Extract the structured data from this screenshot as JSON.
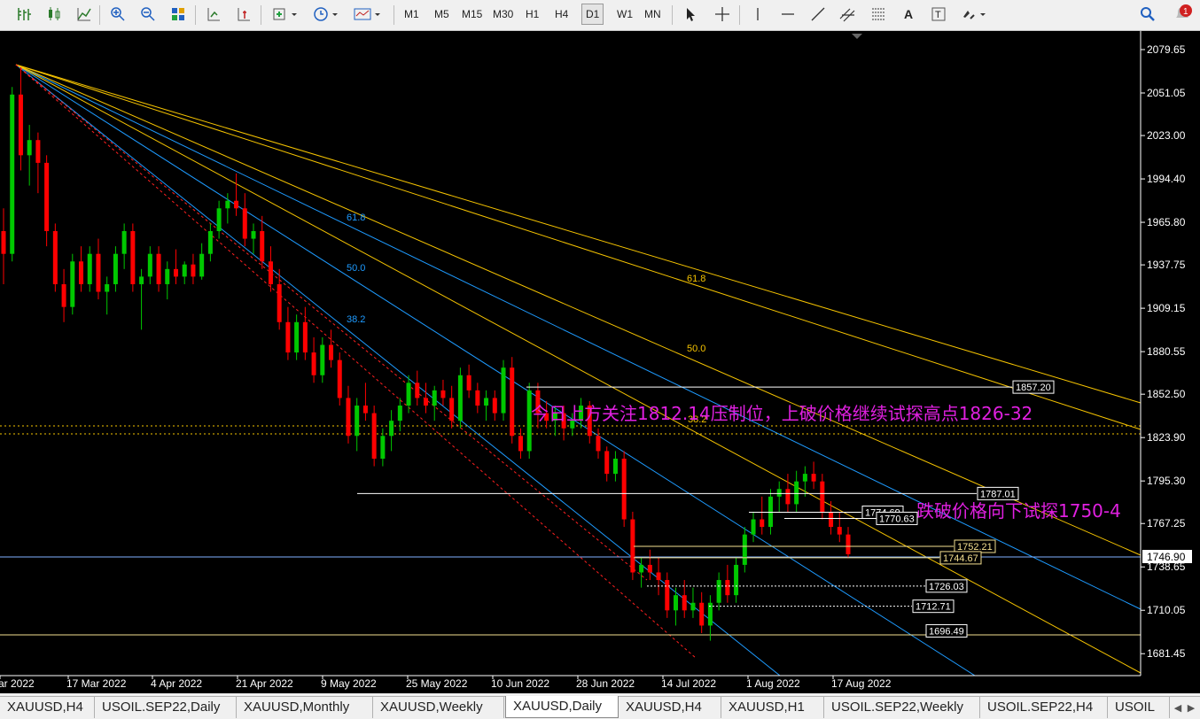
{
  "toolbar": {
    "timeframes": [
      "M1",
      "M5",
      "M15",
      "M30",
      "H1",
      "H4",
      "D1",
      "W1",
      "MN"
    ],
    "active_timeframe": "D1",
    "notification_count": "1"
  },
  "price_axis": {
    "ticks": [
      "2079.65",
      "2051.05",
      "2023.00",
      "1994.40",
      "1965.80",
      "1937.75",
      "1909.15",
      "1880.55",
      "1852.50",
      "1823.90",
      "1795.30",
      "1767.25",
      "1738.65",
      "1710.05",
      "1681.45"
    ],
    "current_price": "1746.90"
  },
  "time_axis": {
    "ticks": [
      "ar 2022",
      "17 Mar 2022",
      "4 Apr 2022",
      "21 Apr 2022",
      "9 May 2022",
      "25 May 2022",
      "10 Jun 2022",
      "28 Jun 2022",
      "14 Jul 2022",
      "1 Aug 2022",
      "17 Aug 2022"
    ]
  },
  "fib_labels": {
    "blue": [
      "61.8",
      "50.0",
      "38.2"
    ],
    "yellow": [
      "61.8",
      "50.0",
      "38.2"
    ]
  },
  "levels": [
    "1857.20",
    "1787.01",
    "1774.69",
    "1770.63",
    "1752.21",
    "1744.67",
    "1726.03",
    "1712.71",
    "1696.49"
  ],
  "annotations": {
    "upper": "今日上方关注1812.14压制位，上破价格继续试探高点1826-32",
    "lower": "跌破价格向下试探1750-4"
  },
  "tabs": [
    "XAUUSD,H4",
    "USOIL.SEP22,Daily",
    "XAUUSD,Monthly",
    "XAUUSD,Weekly",
    "XAUUSD,Daily",
    "XAUUSD,H4",
    "XAUUSD,H1",
    "USOIL.SEP22,Weekly",
    "USOIL.SEP22,H4",
    "USOIL"
  ],
  "active_tab": "XAUUSD,Daily",
  "colors": {
    "bull": "#00c800",
    "bear": "#ff0000",
    "blue_fan": "#1e9bff",
    "yellow_fan": "#f5c300",
    "annotation": "#e020e0",
    "channel": "#ff2020"
  },
  "chart_data": {
    "type": "candlestick",
    "symbol": "XAUUSD",
    "timeframe": "Daily",
    "y_range": [
      1672,
      2092
    ],
    "current_price": 1746.9,
    "horizontal_levels": [
      1857.2,
      1787.01,
      1774.69,
      1770.63,
      1752.21,
      1744.67,
      1726.03,
      1712.71,
      1696.49
    ],
    "candles": [
      [
        1960,
        1975,
        1925,
        1945
      ],
      [
        1945,
        2055,
        1940,
        2050
      ],
      [
        2050,
        2068,
        2000,
        2010
      ],
      [
        2010,
        2030,
        1990,
        2020
      ],
      [
        2020,
        2025,
        1985,
        2005
      ],
      [
        2005,
        2010,
        1950,
        1960
      ],
      [
        1960,
        1965,
        1920,
        1925
      ],
      [
        1925,
        1935,
        1900,
        1910
      ],
      [
        1910,
        1945,
        1905,
        1940
      ],
      [
        1940,
        1950,
        1920,
        1925
      ],
      [
        1925,
        1950,
        1920,
        1945
      ],
      [
        1945,
        1955,
        1915,
        1920
      ],
      [
        1920,
        1930,
        1905,
        1925
      ],
      [
        1925,
        1950,
        1920,
        1945
      ],
      [
        1945,
        1965,
        1935,
        1960
      ],
      [
        1960,
        1965,
        1920,
        1925
      ],
      [
        1925,
        1935,
        1895,
        1930
      ],
      [
        1930,
        1950,
        1925,
        1945
      ],
      [
        1945,
        1950,
        1920,
        1925
      ],
      [
        1925,
        1940,
        1915,
        1935
      ],
      [
        1935,
        1948,
        1925,
        1930
      ],
      [
        1930,
        1940,
        1925,
        1938
      ],
      [
        1938,
        1945,
        1925,
        1930
      ],
      [
        1930,
        1952,
        1928,
        1945
      ],
      [
        1945,
        1965,
        1940,
        1960
      ],
      [
        1960,
        1980,
        1955,
        1975
      ],
      [
        1975,
        1985,
        1965,
        1980
      ],
      [
        1980,
        1998,
        1970,
        1975
      ],
      [
        1975,
        1985,
        1950,
        1955
      ],
      [
        1955,
        1965,
        1945,
        1960
      ],
      [
        1960,
        1970,
        1935,
        1940
      ],
      [
        1940,
        1950,
        1920,
        1925
      ],
      [
        1925,
        1935,
        1895,
        1900
      ],
      [
        1900,
        1910,
        1875,
        1880
      ],
      [
        1880,
        1905,
        1875,
        1900
      ],
      [
        1900,
        1910,
        1875,
        1880
      ],
      [
        1880,
        1890,
        1860,
        1865
      ],
      [
        1865,
        1890,
        1860,
        1885
      ],
      [
        1885,
        1895,
        1870,
        1875
      ],
      [
        1875,
        1880,
        1845,
        1850
      ],
      [
        1850,
        1858,
        1820,
        1825
      ],
      [
        1825,
        1850,
        1815,
        1845
      ],
      [
        1845,
        1860,
        1835,
        1840
      ],
      [
        1840,
        1845,
        1805,
        1810
      ],
      [
        1810,
        1830,
        1805,
        1825
      ],
      [
        1825,
        1842,
        1815,
        1835
      ],
      [
        1835,
        1850,
        1828,
        1845
      ],
      [
        1845,
        1865,
        1840,
        1860
      ],
      [
        1860,
        1868,
        1845,
        1850
      ],
      [
        1850,
        1860,
        1840,
        1845
      ],
      [
        1845,
        1858,
        1835,
        1855
      ],
      [
        1855,
        1862,
        1845,
        1850
      ],
      [
        1850,
        1858,
        1830,
        1835
      ],
      [
        1835,
        1870,
        1830,
        1865
      ],
      [
        1865,
        1872,
        1850,
        1855
      ],
      [
        1855,
        1860,
        1840,
        1845
      ],
      [
        1845,
        1855,
        1835,
        1850
      ],
      [
        1850,
        1855,
        1835,
        1840
      ],
      [
        1840,
        1875,
        1835,
        1870
      ],
      [
        1870,
        1877,
        1820,
        1825
      ],
      [
        1825,
        1830,
        1810,
        1815
      ],
      [
        1815,
        1860,
        1810,
        1855
      ],
      [
        1855,
        1860,
        1830,
        1840
      ],
      [
        1840,
        1848,
        1830,
        1835
      ],
      [
        1835,
        1845,
        1825,
        1840
      ],
      [
        1840,
        1845,
        1822,
        1830
      ],
      [
        1830,
        1840,
        1825,
        1835
      ],
      [
        1835,
        1850,
        1830,
        1845
      ],
      [
        1845,
        1848,
        1820,
        1825
      ],
      [
        1825,
        1830,
        1810,
        1815
      ],
      [
        1815,
        1818,
        1795,
        1800
      ],
      [
        1800,
        1815,
        1795,
        1810
      ],
      [
        1810,
        1815,
        1765,
        1770
      ],
      [
        1770,
        1775,
        1730,
        1735
      ],
      [
        1735,
        1745,
        1725,
        1740
      ],
      [
        1740,
        1750,
        1730,
        1735
      ],
      [
        1735,
        1745,
        1720,
        1730
      ],
      [
        1730,
        1735,
        1705,
        1710
      ],
      [
        1710,
        1725,
        1700,
        1720
      ],
      [
        1720,
        1730,
        1705,
        1710
      ],
      [
        1710,
        1725,
        1705,
        1715
      ],
      [
        1715,
        1722,
        1695,
        1700
      ],
      [
        1700,
        1720,
        1690,
        1715
      ],
      [
        1715,
        1735,
        1710,
        1730
      ],
      [
        1730,
        1740,
        1715,
        1720
      ],
      [
        1720,
        1745,
        1715,
        1740
      ],
      [
        1740,
        1765,
        1735,
        1760
      ],
      [
        1760,
        1775,
        1755,
        1770
      ],
      [
        1770,
        1785,
        1760,
        1765
      ],
      [
        1765,
        1790,
        1760,
        1785
      ],
      [
        1785,
        1795,
        1775,
        1790
      ],
      [
        1790,
        1800,
        1775,
        1780
      ],
      [
        1780,
        1802,
        1775,
        1795
      ],
      [
        1795,
        1805,
        1785,
        1800
      ],
      [
        1800,
        1808,
        1790,
        1795
      ],
      [
        1795,
        1800,
        1770,
        1775
      ],
      [
        1775,
        1782,
        1760,
        1765
      ],
      [
        1765,
        1775,
        1755,
        1760
      ],
      [
        1760,
        1765,
        1745,
        1747
      ]
    ]
  }
}
